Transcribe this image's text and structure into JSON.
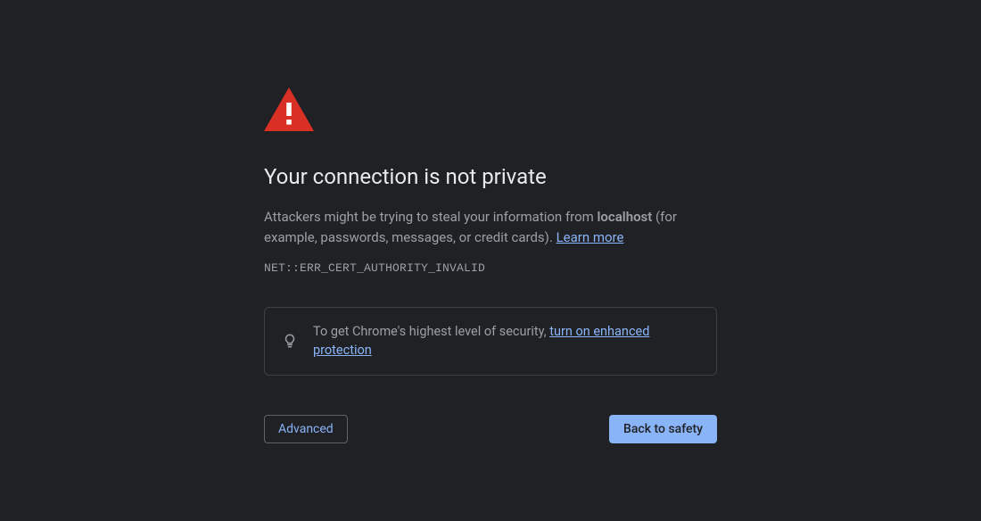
{
  "title": "Your connection is not private",
  "description_prefix": "Attackers might be trying to steal your information from ",
  "hostname": "localhost",
  "description_suffix": " (for example, passwords, messages, or credit cards). ",
  "learn_more_label": "Learn more",
  "error_code": "NET::ERR_CERT_AUTHORITY_INVALID",
  "tip": {
    "prefix": "To get Chrome's highest level of security, ",
    "link_text": "turn on enhanced protection"
  },
  "buttons": {
    "advanced": "Advanced",
    "back_to_safety": "Back to safety"
  },
  "colors": {
    "danger": "#d93025",
    "link": "#8ab4f8",
    "bg": "#202124",
    "text_primary": "#e8eaed",
    "text_secondary": "#9aa0a6"
  }
}
